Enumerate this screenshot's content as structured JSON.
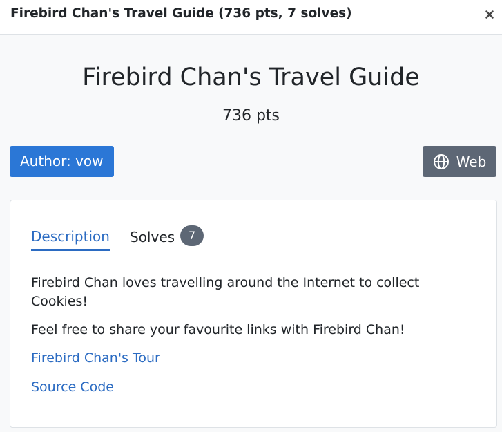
{
  "modal": {
    "title": "Firebird Chan's Travel Guide (736 pts, 7 solves)",
    "close_label": "×"
  },
  "challenge": {
    "name": "Firebird Chan's Travel Guide",
    "points": "736 pts",
    "author": "Author: vow",
    "category": "Web"
  },
  "tabs": {
    "description_label": "Description",
    "solves_label": "Solves",
    "solves_count": "7"
  },
  "description": {
    "paragraph_1": "Firebird Chan loves travelling around the Internet to collect Cookies!",
    "paragraph_2": "Feel free to share your favourite links with Firebird Chan!",
    "links": [
      {
        "label": "Firebird Chan's Tour"
      },
      {
        "label": "Source Code"
      }
    ]
  },
  "colors": {
    "accent": "#2b77d6",
    "link": "#2b6bc2",
    "secondary_badge": "#5d6775",
    "background": "#f8f9fa"
  },
  "icons": {
    "category": "globe-icon",
    "close": "close-icon"
  }
}
